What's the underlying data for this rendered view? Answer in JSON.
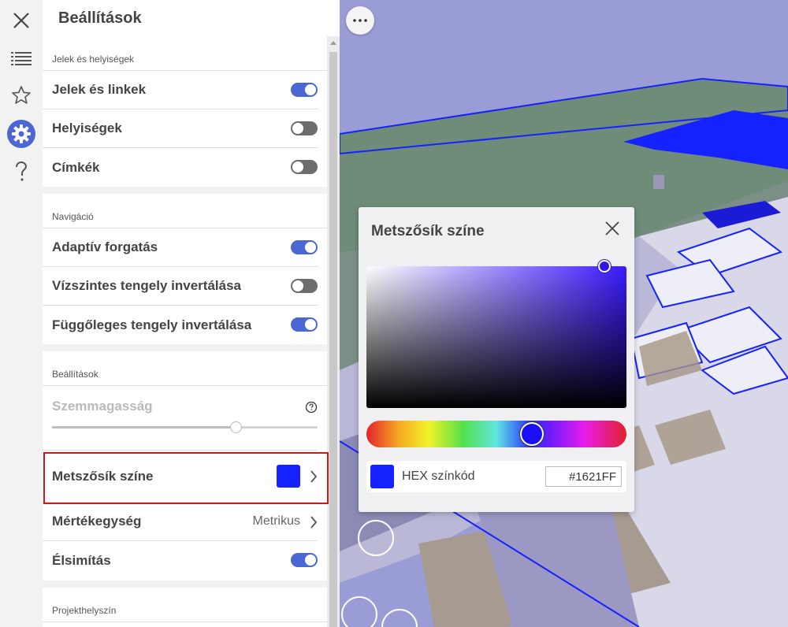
{
  "panel": {
    "title": "Beállítások"
  },
  "sections": {
    "markers": {
      "header": "Jelek és helyiségek",
      "rows": [
        {
          "label": "Jelek és linkek",
          "toggle": "on"
        },
        {
          "label": "Helyiségek",
          "toggle": "off"
        },
        {
          "label": "Címkék",
          "toggle": "off"
        }
      ]
    },
    "navigation": {
      "header": "Navigáció",
      "rows": [
        {
          "label": "Adaptív forgatás",
          "toggle": "on"
        },
        {
          "label": "Vízszintes tengely invertálása",
          "toggle": "off"
        },
        {
          "label": "Függőleges tengely invertálása",
          "toggle": "on"
        }
      ]
    },
    "settings": {
      "header": "Beállítások",
      "eye_height_label": "Szemmagasság",
      "eye_height_fraction": 0.69,
      "section_color_label": "Metszősík színe",
      "section_color": "#1621FF",
      "unit_label": "Mértékegység",
      "unit_value": "Metrikus",
      "smoothing_label": "Élsimítás",
      "smoothing_toggle": "on"
    },
    "location": {
      "header": "Projekthelyszín"
    }
  },
  "popup": {
    "title": "Metszősík színe",
    "hex_label": "HEX színkód",
    "hex_value": "#1621FF"
  },
  "colors": {
    "accent": "#4b67d6",
    "highlight": "#d7141a",
    "clip_plane": "#1621FF"
  },
  "icons": [
    "close-icon",
    "list-icon",
    "star-icon",
    "gear-icon",
    "question-icon",
    "more-icon",
    "chevron-right-icon",
    "help-circle-icon"
  ]
}
